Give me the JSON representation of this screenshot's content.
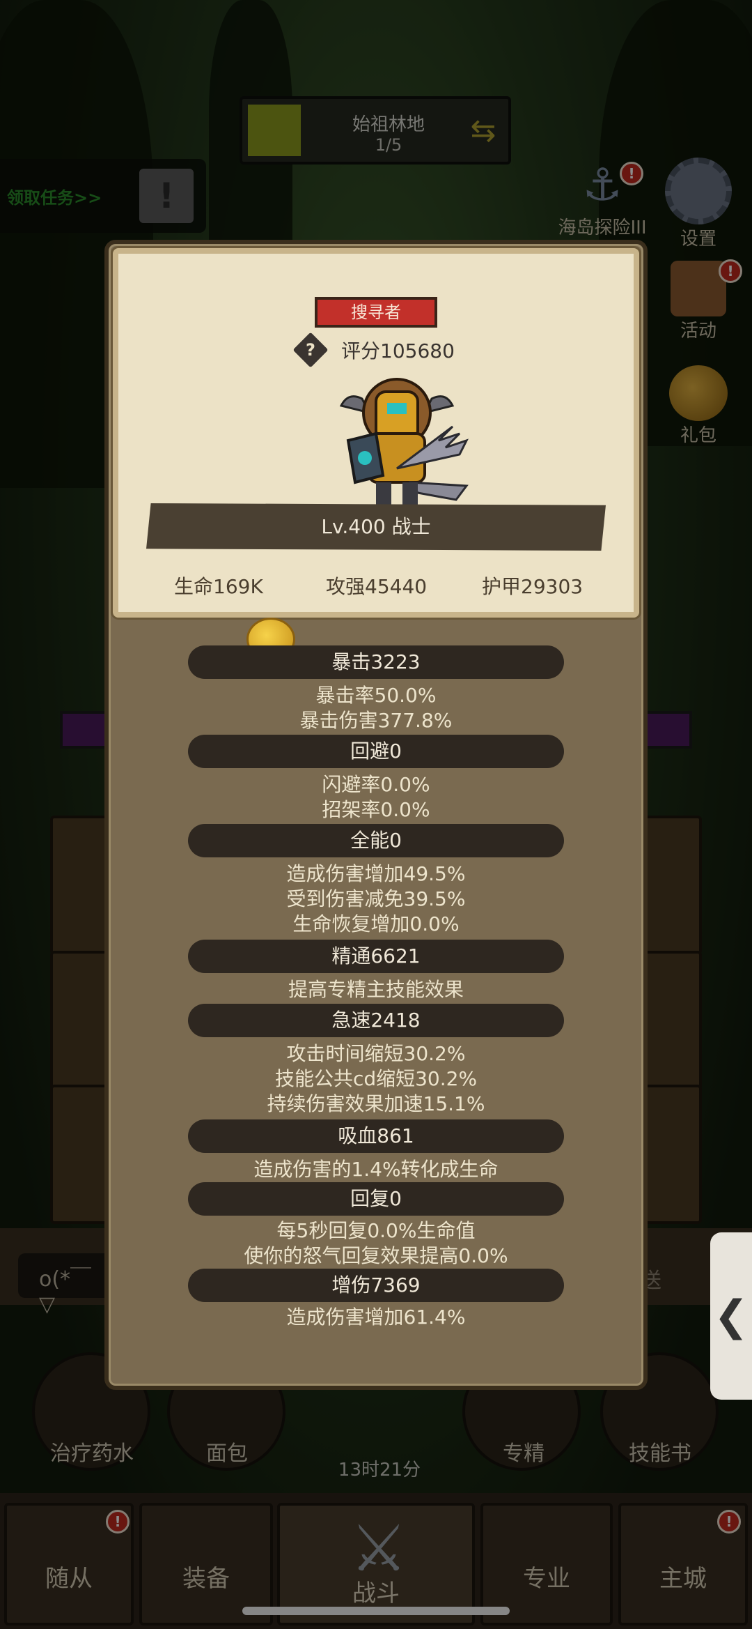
{
  "zone": {
    "name": "始祖林地",
    "progress": "1/5"
  },
  "quest": {
    "label": "领取任务>>",
    "button_glyph": "!"
  },
  "side_menu": [
    {
      "label": "海岛探险III",
      "icon": "anchor-icon",
      "badge": "!"
    },
    {
      "label": "设置",
      "icon": "gear-icon"
    },
    {
      "label": "活动",
      "icon": "scroll-icon",
      "badge": "!"
    },
    {
      "label": "礼包",
      "icon": "helmet-icon"
    }
  ],
  "hero_card": {
    "title": "搜寻者",
    "help_glyph": "?",
    "score": "评分105680",
    "level_class": "Lv.400 战士",
    "hp": "生命169K",
    "attack": "攻强45440",
    "armor": "护甲29303"
  },
  "stats": [
    {
      "header": "暴击3223",
      "lines": [
        "暴击率50.0%",
        "暴击伤害377.8%"
      ]
    },
    {
      "header": "回避0",
      "lines": [
        "闪避率0.0%",
        "招架率0.0%"
      ]
    },
    {
      "header": "全能0",
      "lines": [
        "造成伤害增加49.5%",
        "受到伤害减免39.5%",
        "生命恢复增加0.0%"
      ]
    },
    {
      "header": "精通6621",
      "lines": [
        "提高专精主技能效果"
      ]
    },
    {
      "header": "急速2418",
      "lines": [
        "攻击时间缩短30.2%",
        "技能公共cd缩短30.2%",
        "持续伤害效果加速15.1%"
      ]
    },
    {
      "header": "吸血861",
      "lines": [
        "造成伤害的1.4%转化成生命"
      ]
    },
    {
      "header": "回复0",
      "lines": [
        "每5秒回复0.0%生命值",
        "使你的怒气回复效果提高0.0%"
      ]
    },
    {
      "header": "增伤7369",
      "lines": [
        "造成伤害增加61.4%"
      ]
    }
  ],
  "chat": {
    "input_value": "o(*￣▽",
    "send_label": "送"
  },
  "consumables": [
    {
      "label": "治疗药水"
    },
    {
      "label": "面包"
    },
    {
      "label": "专精"
    },
    {
      "label": "技能书"
    }
  ],
  "timer": "13时21分",
  "bottom_nav": [
    {
      "label": "随从",
      "badge": "!"
    },
    {
      "label": "装备"
    },
    {
      "label": "战斗"
    },
    {
      "label": "专业"
    },
    {
      "label": "主城",
      "badge": "!"
    }
  ],
  "drawer_handle": "❮",
  "colors": {
    "panel_bg": "#7a6a50",
    "card_bg": "#ece2c6",
    "title_badge": "#c2302a",
    "stat_header_bg": "#2e2720",
    "zone_swatch": "#8a9a1e"
  }
}
